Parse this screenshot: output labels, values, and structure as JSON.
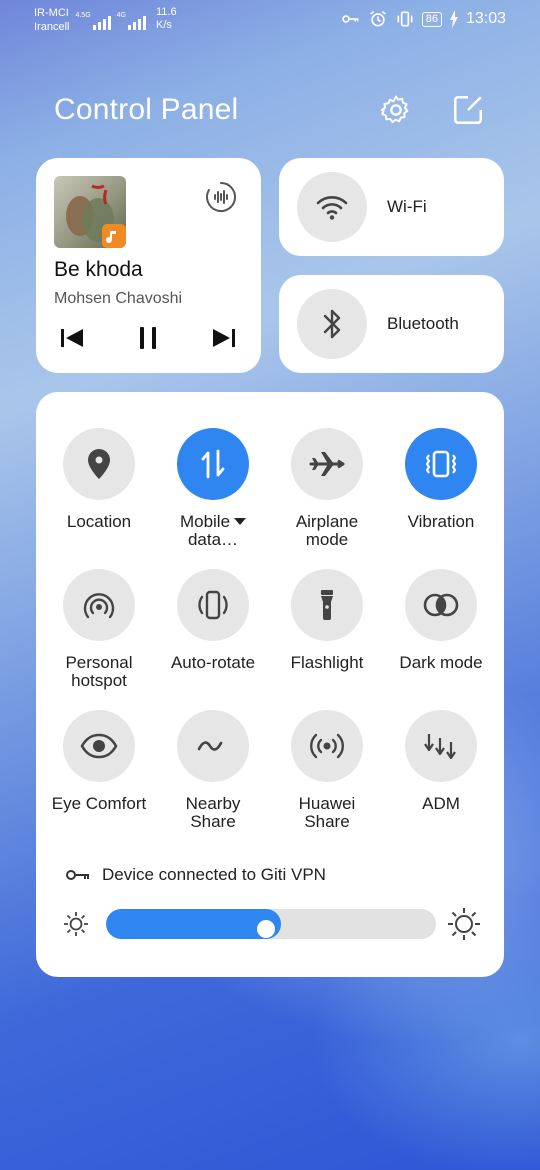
{
  "status_bar": {
    "carrier1": "IR-MCI",
    "carrier2": "Irancell",
    "net1": "4.5G",
    "net2": "4G",
    "speed_value": "11.6",
    "speed_unit": "K/s",
    "battery": "86",
    "time": "13:03"
  },
  "header": {
    "title": "Control Panel"
  },
  "media": {
    "title": "Be khoda",
    "artist": "Mohsen Chavoshi"
  },
  "quick": {
    "wifi_label": "Wi-Fi",
    "bluetooth_label": "Bluetooth"
  },
  "tiles": [
    {
      "label": "Location",
      "icon": "location-icon",
      "on": false
    },
    {
      "label": "Mobile data…",
      "icon": "mobile-data-icon",
      "on": true
    },
    {
      "label": "Airplane mode",
      "icon": "airplane-icon",
      "on": false
    },
    {
      "label": "Vibration",
      "icon": "vibration-icon",
      "on": true
    },
    {
      "label": "Personal hotspot",
      "icon": "hotspot-icon",
      "on": false
    },
    {
      "label": "Auto-rotate",
      "icon": "auto-rotate-icon",
      "on": false
    },
    {
      "label": "Flashlight",
      "icon": "flashlight-icon",
      "on": false
    },
    {
      "label": "Dark mode",
      "icon": "dark-mode-icon",
      "on": false
    },
    {
      "label": "Eye Comfort",
      "icon": "eye-icon",
      "on": false
    },
    {
      "label": "Nearby Share",
      "icon": "nearby-share-icon",
      "on": false
    },
    {
      "label": "Huawei Share",
      "icon": "huawei-share-icon",
      "on": false
    },
    {
      "label": "ADM",
      "icon": "adm-icon",
      "on": false
    }
  ],
  "tile_labels": {
    "mobile_line1": "Mobile",
    "mobile_line2": "data…",
    "airplane_line1": "Airplane",
    "airplane_line2": "mode",
    "hotspot_line1": "Personal",
    "hotspot_line2": "hotspot",
    "nearby_line1": "Nearby",
    "nearby_line2": "Share",
    "huawei_line1": "Huawei",
    "huawei_line2": "Share"
  },
  "vpn": {
    "text": "Device connected to Giti VPN"
  },
  "brightness": {
    "level": 0.53
  },
  "colors": {
    "accent": "#2f86f0",
    "tile_off": "#e6e6e6"
  }
}
